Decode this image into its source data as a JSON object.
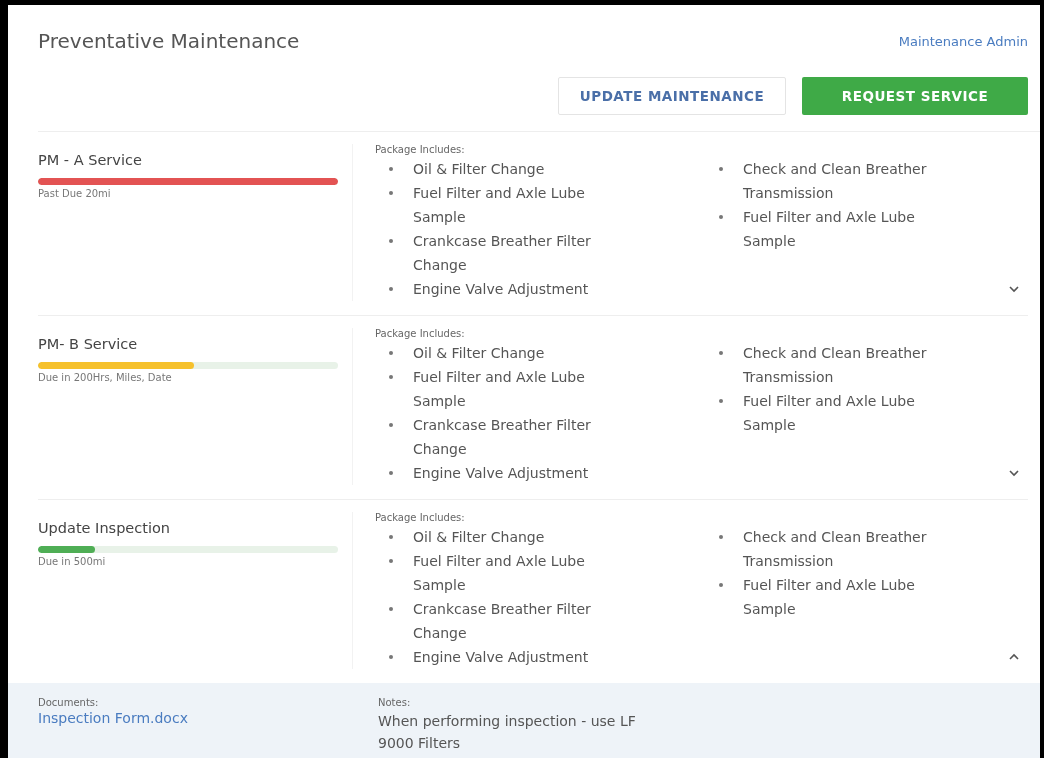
{
  "header": {
    "title": "Preventative Maintenance",
    "admin_link": "Maintenance Admin"
  },
  "buttons": [
    {
      "label": "UPDATE MAINTENANCE",
      "kind": "outline"
    },
    {
      "label": "REQUEST SERVICE",
      "kind": "primary"
    }
  ],
  "services": [
    {
      "name": "PM - A Service",
      "level": 1,
      "color": "#e35353",
      "status": "Past Due 20mi",
      "package_label": "Package Includes:",
      "items_left": [
        "Oil & Filter Change",
        "Fuel Filter and Axle Lube Sample",
        "Crankcase Breather Filter Change",
        "Engine Valve Adjustment"
      ],
      "items_right": [
        "Check and Clean Breather Transmission",
        "Fuel Filter and Axle Lube Sample"
      ],
      "expanded": false
    },
    {
      "name": "PM- B Service",
      "level": 0.52,
      "color": "#f6c12c",
      "status": "Due in 200Hrs, Miles, Date",
      "package_label": "Package Includes:",
      "items_left": [
        "Oil & Filter Change",
        "Fuel Filter and Axle Lube Sample",
        "Crankcase Breather Filter Change",
        "Engine Valve Adjustment"
      ],
      "items_right": [
        "Check and Clean Breather Transmission",
        "Fuel Filter and Axle Lube Sample"
      ],
      "expanded": false
    },
    {
      "name": "Update Inspection",
      "level": 0.19,
      "color": "#4fae55",
      "status": "Due in 500mi",
      "package_label": "Package Includes:",
      "items_left": [
        "Oil & Filter Change",
        "Fuel Filter and Axle Lube Sample",
        "Crankcase Breather Filter Change",
        "Engine Valve Adjustment"
      ],
      "items_right": [
        "Check and Clean Breather Transmission",
        "Fuel Filter and Axle Lube Sample"
      ],
      "expanded": true,
      "details": {
        "documents_label": "Documents:",
        "document_link": "Inspection Form.docx",
        "notes_label": "Notes:",
        "notes": "When performing inspection - use LF 9000 Filters"
      }
    }
  ]
}
